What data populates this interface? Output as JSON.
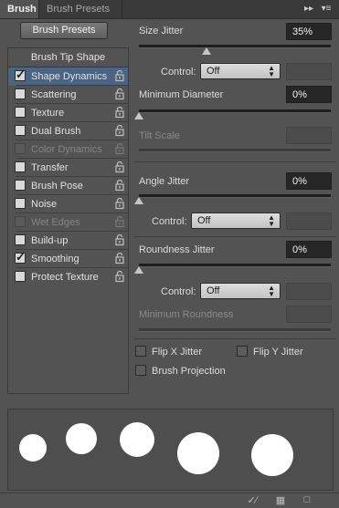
{
  "tabs": [
    {
      "label": "Brush"
    },
    {
      "label": "Brush Presets"
    }
  ],
  "header_icons": {
    "collapse": "double-chevron-icon",
    "menu": "panel-menu-icon"
  },
  "left": {
    "presets_button": "Brush Presets",
    "tip_shape": "Brush Tip Shape",
    "items": [
      {
        "label": "Shape Dynamics",
        "checked": true,
        "selected": true,
        "enabled": true
      },
      {
        "label": "Scattering",
        "checked": false,
        "enabled": true
      },
      {
        "label": "Texture",
        "checked": false,
        "enabled": true
      },
      {
        "label": "Dual Brush",
        "checked": false,
        "enabled": true
      },
      {
        "label": "Color Dynamics",
        "checked": false,
        "enabled": false
      },
      {
        "label": "Transfer",
        "checked": false,
        "enabled": true
      },
      {
        "label": "Brush Pose",
        "checked": false,
        "enabled": true
      },
      {
        "label": "Noise",
        "checked": false,
        "enabled": true
      },
      {
        "label": "Wet Edges",
        "checked": false,
        "enabled": false
      },
      {
        "label": "Build-up",
        "checked": false,
        "enabled": true
      },
      {
        "label": "Smoothing",
        "checked": true,
        "enabled": true
      },
      {
        "label": "Protect Texture",
        "checked": false,
        "enabled": true
      }
    ]
  },
  "right": {
    "size_jitter": {
      "label": "Size Jitter",
      "value": "35%",
      "slider": 0.35
    },
    "control1": {
      "label": "Control:",
      "value": "Off"
    },
    "min_diameter": {
      "label": "Minimum Diameter",
      "value": "0%",
      "slider": 0
    },
    "tilt_scale": {
      "label": "Tilt Scale"
    },
    "angle_jitter": {
      "label": "Angle Jitter",
      "value": "0%",
      "slider": 0
    },
    "control2": {
      "label": "Control:",
      "value": "Off"
    },
    "roundness_jitter": {
      "label": "Roundness Jitter",
      "value": "0%",
      "slider": 0
    },
    "control3": {
      "label": "Control:",
      "value": "Off"
    },
    "min_roundness": {
      "label": "Minimum Roundness"
    },
    "flip_x": {
      "label": "Flip X Jitter",
      "checked": false
    },
    "flip_y": {
      "label": "Flip Y Jitter",
      "checked": false
    },
    "projection": {
      "label": "Brush Projection",
      "checked": false
    }
  },
  "preview_dots": [
    0.29,
    0.33,
    0.37,
    0.45,
    0.45
  ],
  "bottom_icons": [
    "brush-toggle-icon",
    "grid-icon",
    "new-preset-icon"
  ]
}
